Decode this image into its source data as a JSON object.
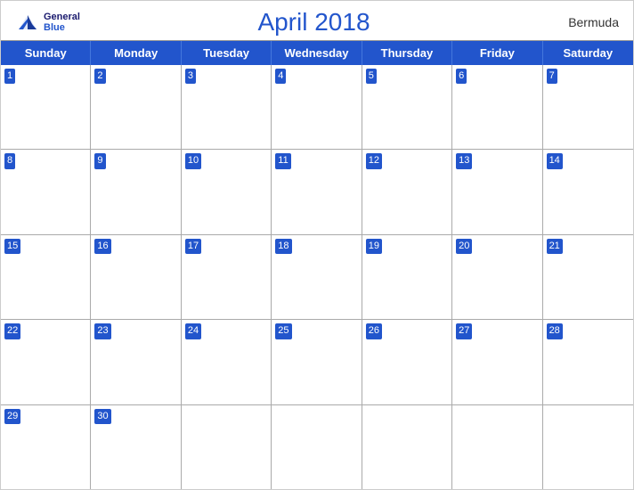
{
  "header": {
    "logo": {
      "general": "General",
      "blue": "Blue"
    },
    "title": "April 2018",
    "region": "Bermuda"
  },
  "days_of_week": [
    "Sunday",
    "Monday",
    "Tuesday",
    "Wednesday",
    "Thursday",
    "Friday",
    "Saturday"
  ],
  "weeks": [
    [
      {
        "date": 1,
        "in_month": true
      },
      {
        "date": 2,
        "in_month": true
      },
      {
        "date": 3,
        "in_month": true
      },
      {
        "date": 4,
        "in_month": true
      },
      {
        "date": 5,
        "in_month": true
      },
      {
        "date": 6,
        "in_month": true
      },
      {
        "date": 7,
        "in_month": true
      }
    ],
    [
      {
        "date": 8,
        "in_month": true
      },
      {
        "date": 9,
        "in_month": true
      },
      {
        "date": 10,
        "in_month": true
      },
      {
        "date": 11,
        "in_month": true
      },
      {
        "date": 12,
        "in_month": true
      },
      {
        "date": 13,
        "in_month": true
      },
      {
        "date": 14,
        "in_month": true
      }
    ],
    [
      {
        "date": 15,
        "in_month": true
      },
      {
        "date": 16,
        "in_month": true
      },
      {
        "date": 17,
        "in_month": true
      },
      {
        "date": 18,
        "in_month": true
      },
      {
        "date": 19,
        "in_month": true
      },
      {
        "date": 20,
        "in_month": true
      },
      {
        "date": 21,
        "in_month": true
      }
    ],
    [
      {
        "date": 22,
        "in_month": true
      },
      {
        "date": 23,
        "in_month": true
      },
      {
        "date": 24,
        "in_month": true
      },
      {
        "date": 25,
        "in_month": true
      },
      {
        "date": 26,
        "in_month": true
      },
      {
        "date": 27,
        "in_month": true
      },
      {
        "date": 28,
        "in_month": true
      }
    ],
    [
      {
        "date": 29,
        "in_month": true
      },
      {
        "date": 30,
        "in_month": true
      },
      {
        "date": null,
        "in_month": false
      },
      {
        "date": null,
        "in_month": false
      },
      {
        "date": null,
        "in_month": false
      },
      {
        "date": null,
        "in_month": false
      },
      {
        "date": null,
        "in_month": false
      }
    ]
  ]
}
